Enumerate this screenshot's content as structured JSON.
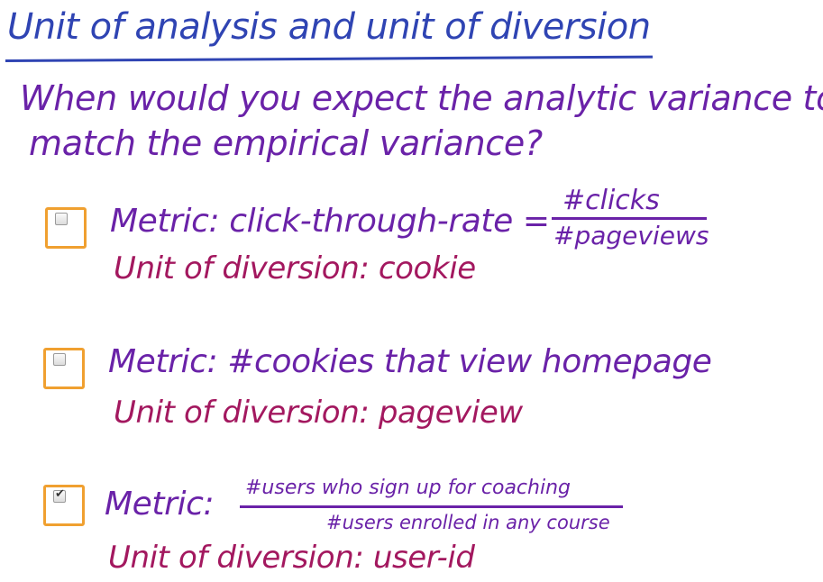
{
  "header": {
    "title": "Unit of analysis and unit of diversion"
  },
  "question": {
    "line1": "When would you expect the analytic variance to",
    "line2": "match the empirical variance?"
  },
  "options": [
    {
      "checked": false,
      "metric_label": "Metric: click-through-rate =",
      "fraction_numerator": "#clicks",
      "fraction_denominator": "#pageviews",
      "unit_label": "Unit of diversion: cookie"
    },
    {
      "checked": false,
      "metric_label": "Metric: #cookies that view homepage",
      "unit_label": "Unit of diversion: pageview"
    },
    {
      "checked": true,
      "metric_label": "Metric:",
      "fraction_numerator": "#users who sign up for coaching",
      "fraction_denominator": "#users enrolled in any course",
      "unit_label": "Unit of diversion: user-id"
    }
  ],
  "colors": {
    "title": "#2f44b3",
    "question": "#6a22a8",
    "metric": "#6a22a8",
    "unit": "#a3185f",
    "checkbox_border": "#f0a030"
  }
}
